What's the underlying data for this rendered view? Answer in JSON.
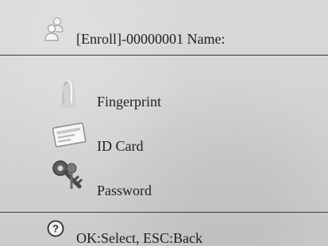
{
  "header": {
    "icon": "users-icon",
    "title": "[Enroll]-00000001 Name:"
  },
  "menu": {
    "items": [
      {
        "icon": "fingerprint-icon",
        "label": "Fingerprint"
      },
      {
        "icon": "id-card-icon",
        "label": "ID Card"
      },
      {
        "icon": "key-icon",
        "label": "Password"
      }
    ]
  },
  "footer": {
    "icon": "help-icon",
    "hint": "OK:Select, ESC:Back"
  }
}
